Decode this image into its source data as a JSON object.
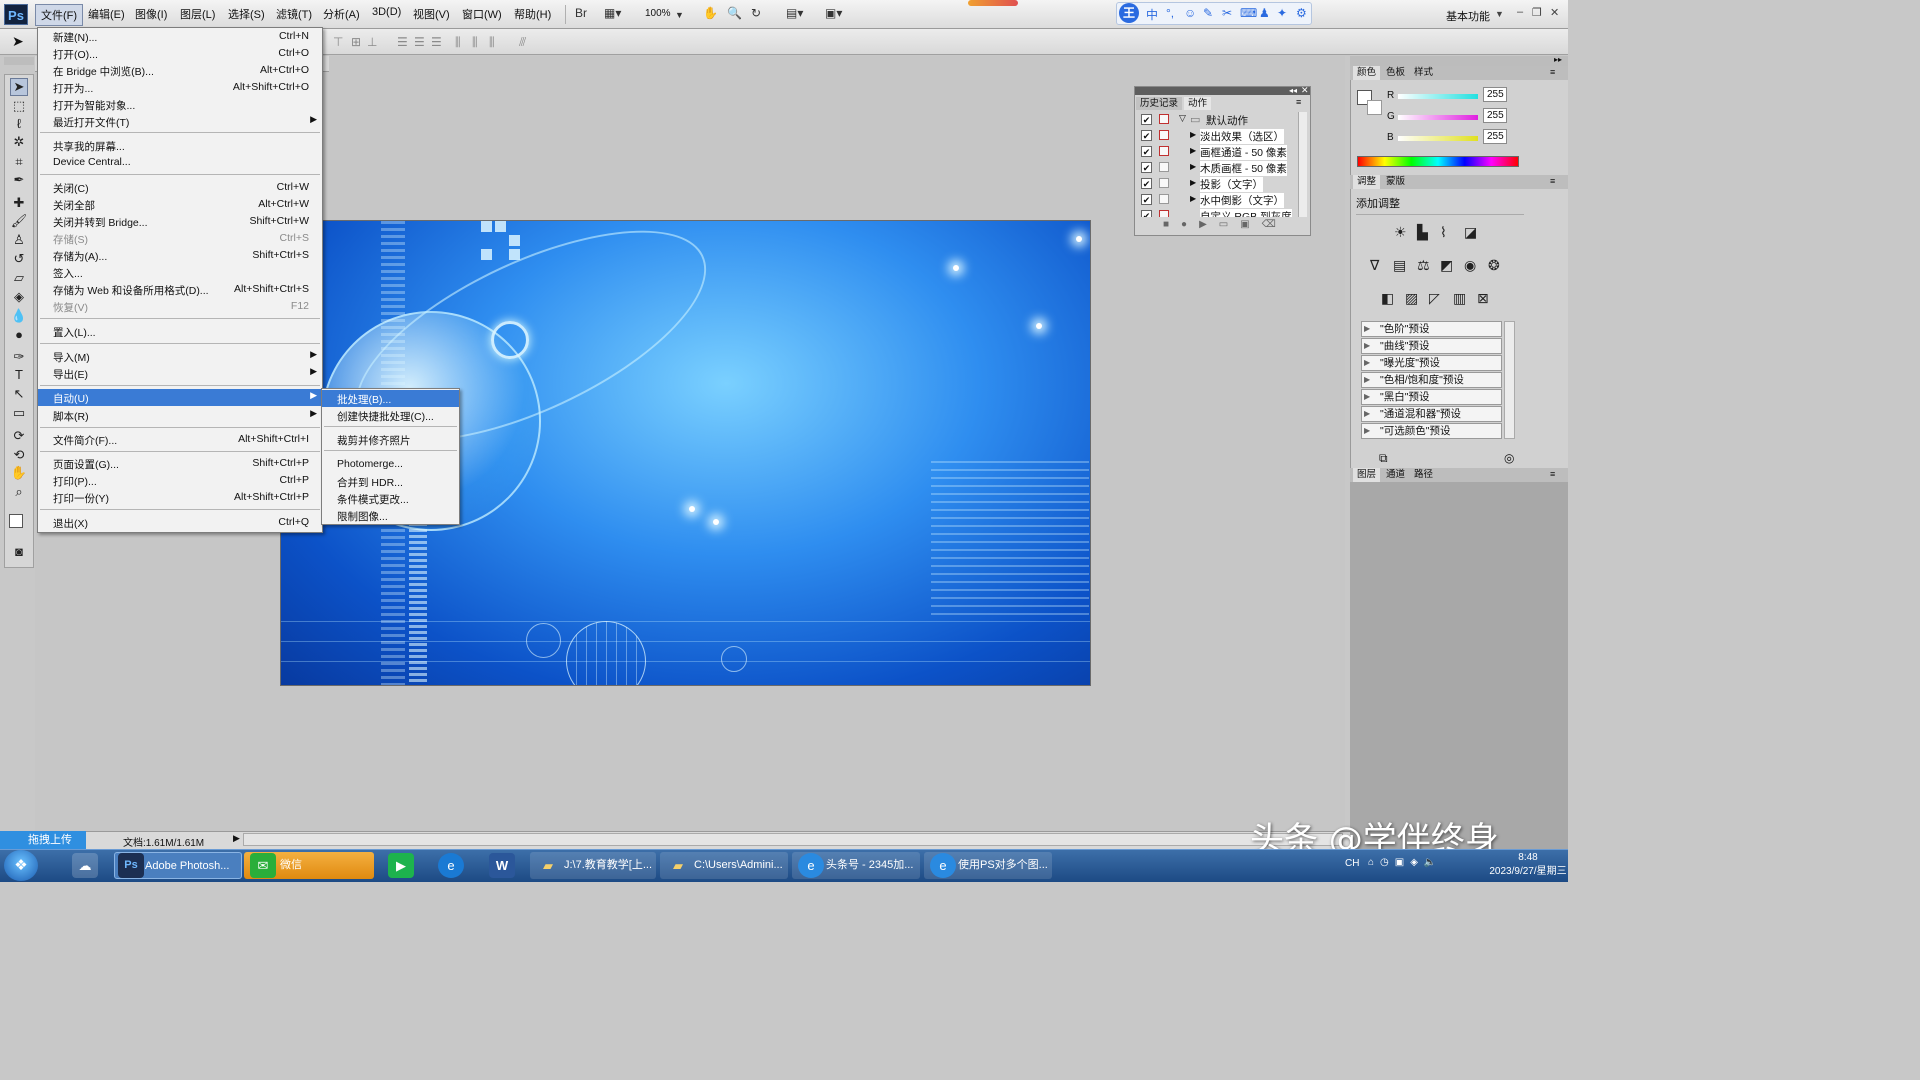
{
  "menubar": {
    "logo": "Ps",
    "items": [
      "文件(F)",
      "编辑(E)",
      "图像(I)",
      "图层(L)",
      "选择(S)",
      "滤镜(T)",
      "分析(A)",
      "3D(D)",
      "视图(V)",
      "窗口(W)",
      "帮助(H)"
    ],
    "zoom": "100%",
    "workspace": "基本功能",
    "ime_logo": "王"
  },
  "file_menu": {
    "items": [
      {
        "label": "新建(N)...",
        "shortcut": "Ctrl+N"
      },
      {
        "label": "打开(O)...",
        "shortcut": "Ctrl+O"
      },
      {
        "label": "在 Bridge 中浏览(B)...",
        "shortcut": "Alt+Ctrl+O"
      },
      {
        "label": "打开为...",
        "shortcut": "Alt+Shift+Ctrl+O"
      },
      {
        "label": "打开为智能对象...",
        "shortcut": ""
      },
      {
        "label": "最近打开文件(T)",
        "shortcut": ""
      },
      {
        "label": "共享我的屏幕...",
        "shortcut": ""
      },
      {
        "label": "Device Central...",
        "shortcut": ""
      },
      {
        "label": "关闭(C)",
        "shortcut": "Ctrl+W"
      },
      {
        "label": "关闭全部",
        "shortcut": "Alt+Ctrl+W"
      },
      {
        "label": "关闭并转到 Bridge...",
        "shortcut": "Shift+Ctrl+W"
      },
      {
        "label": "存储(S)",
        "shortcut": "Ctrl+S"
      },
      {
        "label": "存储为(A)...",
        "shortcut": "Shift+Ctrl+S"
      },
      {
        "label": "签入...",
        "shortcut": ""
      },
      {
        "label": "存储为 Web 和设备所用格式(D)...",
        "shortcut": "Alt+Shift+Ctrl+S"
      },
      {
        "label": "恢复(V)",
        "shortcut": "F12"
      },
      {
        "label": "置入(L)...",
        "shortcut": ""
      },
      {
        "label": "导入(M)",
        "shortcut": ""
      },
      {
        "label": "导出(E)",
        "shortcut": ""
      },
      {
        "label": "自动(U)",
        "shortcut": ""
      },
      {
        "label": "脚本(R)",
        "shortcut": ""
      },
      {
        "label": "文件简介(F)...",
        "shortcut": "Alt+Shift+Ctrl+I"
      },
      {
        "label": "页面设置(G)...",
        "shortcut": "Shift+Ctrl+P"
      },
      {
        "label": "打印(P)...",
        "shortcut": "Ctrl+P"
      },
      {
        "label": "打印一份(Y)",
        "shortcut": "Alt+Shift+Ctrl+P"
      },
      {
        "label": "退出(X)",
        "shortcut": "Ctrl+Q"
      }
    ]
  },
  "automate_submenu": {
    "items": [
      "批处理(B)...",
      "创建快捷批处理(C)...",
      "裁剪并修齐照片",
      "Photomerge...",
      "合并到 HDR...",
      "条件模式更改...",
      "限制图像..."
    ]
  },
  "actions_panel": {
    "tabs": [
      "历史记录",
      "动作"
    ],
    "set_name": "默认动作",
    "actions": [
      "淡出效果（选区）",
      "画框通道 - 50 像素",
      "木质画框 - 50 像素",
      "投影（文字）",
      "水中倒影（文字）",
      "自定义 RGB 到灰度"
    ]
  },
  "color_panel": {
    "tabs": [
      "颜色",
      "色板",
      "样式"
    ],
    "channels": [
      {
        "label": "R",
        "value": "255"
      },
      {
        "label": "G",
        "value": "255"
      },
      {
        "label": "B",
        "value": "255"
      }
    ],
    "slider_colors": [
      "#22e0e0",
      "#e020e0",
      "#e0e020"
    ]
  },
  "adjust_panel": {
    "tabs": [
      "调整",
      "蒙版"
    ],
    "title": "添加调整",
    "presets": [
      "\"色阶\"预设",
      "\"曲线\"预设",
      "\"曝光度\"预设",
      "\"色相/饱和度\"预设",
      "\"黑白\"预设",
      "\"通道混和器\"预设",
      "\"可选颜色\"预设"
    ]
  },
  "layers_panel": {
    "tabs": [
      "图层",
      "通道",
      "路径"
    ]
  },
  "status": {
    "upload": "拖拽上传",
    "docsize": "文档:1.61M/1.61M"
  },
  "taskbar": {
    "apps": [
      "Adobe Photosh...",
      "微信",
      "J:\\7.教育教学[上...",
      "C:\\Users\\Admini...",
      "头条号 - 2345加...",
      "使用PS对多个图..."
    ],
    "time": "8:48",
    "date": "2023/9/27/星期三",
    "lang": "CH"
  },
  "watermark": "头条 @学伴终身",
  "colors": {
    "highlight": "#3a7bd5",
    "menu_bg": "#f2f2f2",
    "taskbar": "#1d4a84"
  }
}
